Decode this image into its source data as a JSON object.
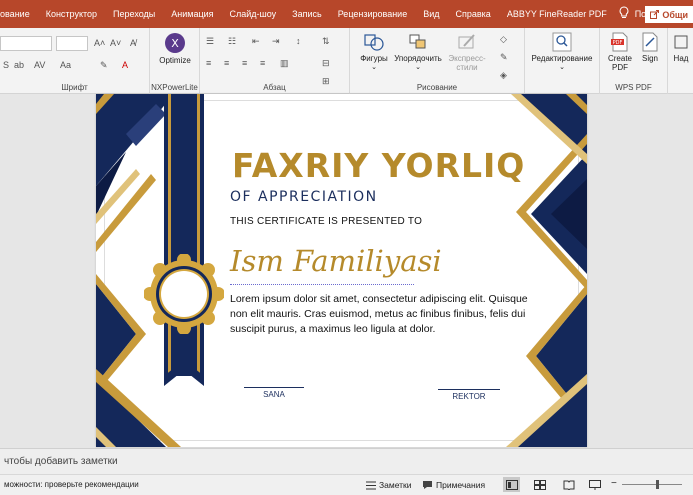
{
  "ribbon_tabs": [
    "ование",
    "Конструктор",
    "Переходы",
    "Анимация",
    "Слайд-шоу",
    "Запись",
    "Рецензирование",
    "Вид",
    "Справка",
    "ABBYY FineReader PDF"
  ],
  "help_label": "Помощ",
  "share_label": "Общи",
  "groups": {
    "font": "Шрифт",
    "nxpower": "NXPowerLite",
    "paragraph": "Абзац",
    "drawing": "Рисование",
    "wps": "WPS PDF"
  },
  "buttons": {
    "optimize": "Optimize",
    "shapes": "Фигуры",
    "arrange": "Упорядочить",
    "styles": "Экспресс-стили",
    "editing": "Редактирование",
    "create_pdf": "Create PDF",
    "sign": "Sign",
    "addins": "Над"
  },
  "slide": {
    "title": "FAXRIY YORLIQ",
    "subtitle": "OF APPRECIATION",
    "presented": "THIS CERTIFICATE IS PRESENTED TO",
    "name": "Ism Familiyasi",
    "body": "Lorem ipsum dolor sit amet, consectetur adipiscing elit. Quisque non elit mauris. Cras euismod, metus ac finibus finibus, felis dui suscipit purus, a maximus leo ligula at dolor.",
    "sig_left": "SANA",
    "sig_right": "REKTOR"
  },
  "notes_placeholder": "чтобы добавить заметки",
  "status": {
    "accessibility": "можности: проверьте рекомендации",
    "notes_btn": "Заметки",
    "comments_btn": "Примечания"
  },
  "colors": {
    "ribbon": "#b7472a",
    "navy": "#14285a",
    "gold": "#b58a2b"
  }
}
